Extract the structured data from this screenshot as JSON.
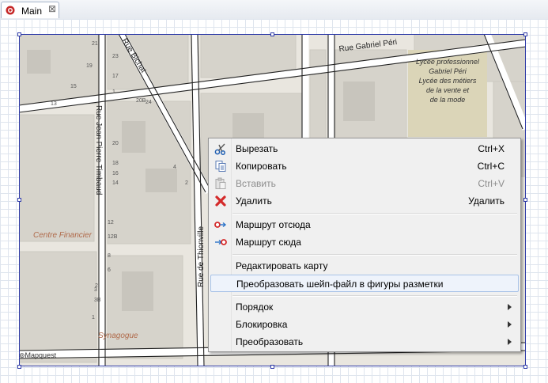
{
  "tab": {
    "title": "Main",
    "icon": "app-icon",
    "close_icon": "close-tab-icon",
    "close_glyph": "⊠"
  },
  "map": {
    "attribution": "Mapquest",
    "streets": [
      "Rue Gabriel Péri",
      "Rue Jean Pierre Timbaud",
      "Rue de Thionville",
      "Rue Bichat",
      "Rue Gabriel Péri"
    ],
    "places": [
      "Lycée professionnel",
      "Gabriel Péri",
      "Lycée des métiers",
      "de la vente et",
      "de la mode",
      "Centre Financier",
      "Synagogue"
    ],
    "house_numbers": [
      "21",
      "19",
      "15",
      "13",
      "23",
      "17",
      "1",
      "24",
      "20B",
      "20",
      "18",
      "14",
      "16",
      "4",
      "2",
      "12",
      "12B",
      "8",
      "6",
      "2",
      "3",
      "3B",
      "1"
    ],
    "colors": {
      "ground": "#e9e6df",
      "block": "#d7d4cc",
      "road": "#ffffff",
      "street_line": "#222222",
      "park": "#d9d2b4",
      "label": "#b06a4a"
    }
  },
  "menu": {
    "items": [
      {
        "key": "cut",
        "label": "Вырезать",
        "shortcut": "Ctrl+X",
        "icon": "scissors-icon",
        "disabled": false
      },
      {
        "key": "copy",
        "label": "Копировать",
        "shortcut": "Ctrl+C",
        "icon": "copy-icon",
        "disabled": false
      },
      {
        "key": "paste",
        "label": "Вставить",
        "shortcut": "Ctrl+V",
        "icon": "paste-icon",
        "disabled": true
      },
      {
        "key": "delete",
        "label": "Удалить",
        "shortcut": "Удалить",
        "icon": "delete-icon",
        "disabled": false
      },
      {
        "key": "route_from",
        "label": "Маршрут отсюда",
        "shortcut": "",
        "icon": "route-from-icon",
        "disabled": false
      },
      {
        "key": "route_to",
        "label": "Маршрут сюда",
        "shortcut": "",
        "icon": "route-to-icon",
        "disabled": false
      },
      {
        "key": "edit_map",
        "label": "Редактировать карту",
        "shortcut": "",
        "icon": "",
        "disabled": false
      },
      {
        "key": "convert_shapefile",
        "label": "Преобразовать шейп-файл в фигуры разметки",
        "shortcut": "",
        "icon": "",
        "disabled": false,
        "highlighted": true
      },
      {
        "key": "order",
        "label": "Порядок",
        "submenu": true
      },
      {
        "key": "lock",
        "label": "Блокировка",
        "submenu": true
      },
      {
        "key": "transform",
        "label": "Преобразовать",
        "submenu": true
      }
    ]
  }
}
